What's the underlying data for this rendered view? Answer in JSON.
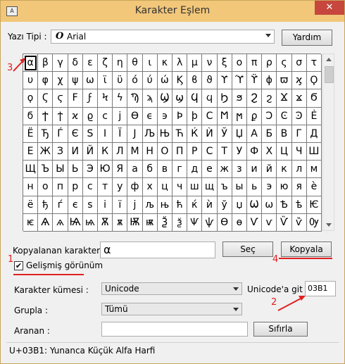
{
  "window": {
    "title": "Karakter Eşlem",
    "close_glyph": "✕",
    "app_icon_glyph": "A"
  },
  "font": {
    "label": "Yazı Tipi :",
    "icon": "O",
    "value": "Arial",
    "help_button": "Yardım"
  },
  "characters": [
    "α",
    "β",
    "γ",
    "δ",
    "ε",
    "ζ",
    "η",
    "θ",
    "ι",
    "κ",
    "λ",
    "μ",
    "ν",
    "ξ",
    "ο",
    "π",
    "ρ",
    "ς",
    "σ",
    "τ",
    "υ",
    "φ",
    "χ",
    "ψ",
    "ω",
    "ϊ",
    "ϋ",
    "ό",
    "ύ",
    "ώ",
    "Ϗ",
    "ϐ",
    "ϑ",
    "ϒ",
    "ϓ",
    "ϔ",
    "ϕ",
    "ϖ",
    "ϗ",
    "Ϙ",
    "ϙ",
    "Ϛ",
    "ϛ",
    "Ϝ",
    "ϝ",
    "Ϟ",
    "ϟ",
    "Ϡ",
    "ϡ",
    "Ϣ",
    "ϣ",
    "Ϥ",
    "ϥ",
    "Ϧ",
    "ϧ",
    "Ϩ",
    "ϩ",
    "Ϫ",
    "ϫ",
    "Ϭ",
    "ϭ",
    "Ϯ",
    "ϯ",
    "ϰ",
    "ϱ",
    "ϲ",
    "ϳ",
    "ϴ",
    "ϵ",
    "϶",
    "Ϸ",
    "ϸ",
    "Ϲ",
    "Ϻ",
    "ϻ",
    "ϼ",
    "Ͻ",
    "Ͼ",
    "Ͽ",
    "Ѐ",
    "Ё",
    "Ђ",
    "Ѓ",
    "Є",
    "Ѕ",
    "І",
    "Ї",
    "Ј",
    "Љ",
    "Њ",
    "Ћ",
    "Ќ",
    "Ѝ",
    "Ў",
    "Џ",
    "А",
    "Б",
    "В",
    "Г",
    "Д",
    "Е",
    "Ж",
    "З",
    "И",
    "Й",
    "К",
    "Л",
    "М",
    "Н",
    "О",
    "П",
    "Р",
    "С",
    "Т",
    "У",
    "Ф",
    "Х",
    "Ц",
    "Ч",
    "Ш",
    "Щ",
    "Ъ",
    "Ы",
    "Ь",
    "Э",
    "Ю",
    "Я",
    "а",
    "б",
    "в",
    "г",
    "д",
    "е",
    "ж",
    "з",
    "и",
    "й",
    "к",
    "л",
    "м",
    "н",
    "о",
    "п",
    "р",
    "с",
    "т",
    "у",
    "ф",
    "х",
    "ц",
    "ч",
    "ш",
    "щ",
    "ъ",
    "ы",
    "ь",
    "э",
    "ю",
    "я",
    "ѐ",
    "ё",
    "ђ",
    "ѓ",
    "є",
    "ѕ",
    "і",
    "ї",
    "ј",
    "љ",
    "њ",
    "ћ",
    "ќ",
    "ѝ",
    "ў",
    "џ",
    "Ѡ",
    "ѡ",
    "Ѣ",
    "ѣ",
    "Ѥ",
    "ѥ",
    "Ѧ",
    "ѧ",
    "Ѩ",
    "ѩ",
    "Ѫ",
    "ѫ",
    "Ѭ",
    "ѭ",
    "Ѯ",
    "ѯ",
    "Ѱ",
    "ѱ",
    "Ѳ",
    "ѳ",
    "Ѵ",
    "ѵ",
    "Ѷ",
    "ѷ",
    "Ѹ"
  ],
  "copy": {
    "label": "Kopyalanan karakterler :",
    "value": "α",
    "select_button": "Seç",
    "copy_button": "Kopyala"
  },
  "advanced": {
    "label": "Gelişmiş görünüm",
    "checked": "✔"
  },
  "charset": {
    "label": "Karakter kümesi :",
    "value": "Unicode"
  },
  "unicode_goto": {
    "label": "Unicode'a git :",
    "value": "03B1"
  },
  "group": {
    "label": "Grupla :",
    "value": "Tümü"
  },
  "search": {
    "label": "Aranan :",
    "reset_button": "Sıfırla"
  },
  "status": "U+03B1: Yunanca Küçük Alfa Harfi",
  "annotations": [
    "1",
    "2",
    "3",
    "4"
  ]
}
